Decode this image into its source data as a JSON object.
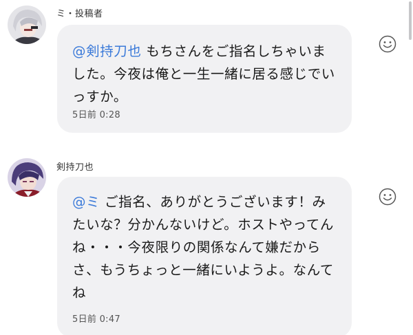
{
  "messages": [
    {
      "author": "ミ・投稿者",
      "mention": "@剣持刀也",
      "text": " もちさんをご指名しちゃいました。今夜は俺と一生一緒に居る感じでいっすか。",
      "timestamp": "5日前 0:28",
      "reaction_icon": "smiley-icon"
    },
    {
      "author": "剣持刀也",
      "mention": "@ミ",
      "text": " ご指名、ありがとうございます！みたいな？分かんないけど。ホストやってんね・・・今夜限りの関係なんて嫌だからさ、もうちょっと一緒にいようよ。なんてね",
      "timestamp": "5日前 0:47",
      "reaction_icon": "smiley-icon"
    }
  ],
  "colors": {
    "bubble": "#f1f1f3",
    "mention": "#3b7ad9",
    "text": "#1a1a1a",
    "timestamp": "#555555"
  }
}
